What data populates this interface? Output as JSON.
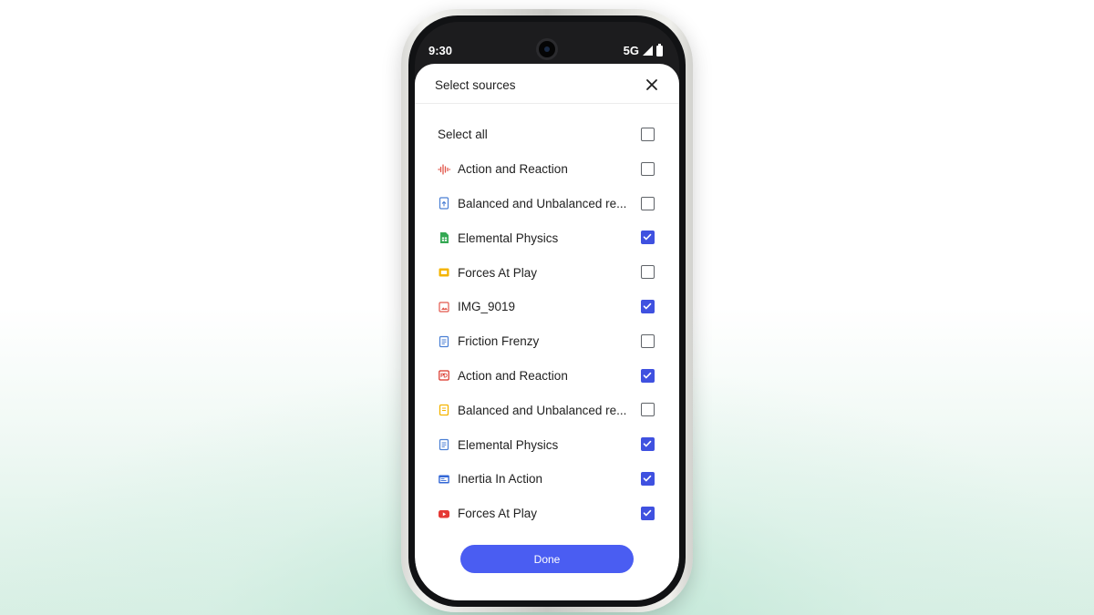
{
  "status_bar": {
    "time": "9:30",
    "network": "5G"
  },
  "dialog": {
    "title": "Select sources",
    "close_icon": "close-icon",
    "select_all": {
      "label": "Select all",
      "checked": false
    },
    "sources": [
      {
        "label": "Action and Reaction",
        "icon": "audio-icon",
        "color": "#e2574c",
        "checked": false
      },
      {
        "label": "Balanced and Unbalanced re...",
        "icon": "doc-upload-icon",
        "color": "#4a7fd4",
        "checked": false
      },
      {
        "label": "Elemental Physics",
        "icon": "sheets-icon",
        "color": "#34a853",
        "checked": true
      },
      {
        "label": "Forces At Play",
        "icon": "slides-icon",
        "color": "#f4b400",
        "checked": false
      },
      {
        "label": "IMG_9019",
        "icon": "image-icon",
        "color": "#e2574c",
        "checked": true
      },
      {
        "label": "Friction Frenzy",
        "icon": "docs-icon",
        "color": "#4a7fd4",
        "checked": false
      },
      {
        "label": "Action and Reaction",
        "icon": "pdf-icon",
        "color": "#d93025",
        "checked": true
      },
      {
        "label": "Balanced and Unbalanced re...",
        "icon": "note-icon",
        "color": "#f4b400",
        "checked": false
      },
      {
        "label": "Elemental Physics",
        "icon": "docs-icon",
        "color": "#4a7fd4",
        "checked": true
      },
      {
        "label": "Inertia In Action",
        "icon": "web-icon",
        "color": "#3367d6",
        "checked": true
      },
      {
        "label": "Forces At Play",
        "icon": "youtube-icon",
        "color": "#e53935",
        "checked": true
      }
    ],
    "done_label": "Done"
  },
  "colors": {
    "accent": "#4a5df2",
    "checkbox_checked": "#3f51e0"
  }
}
